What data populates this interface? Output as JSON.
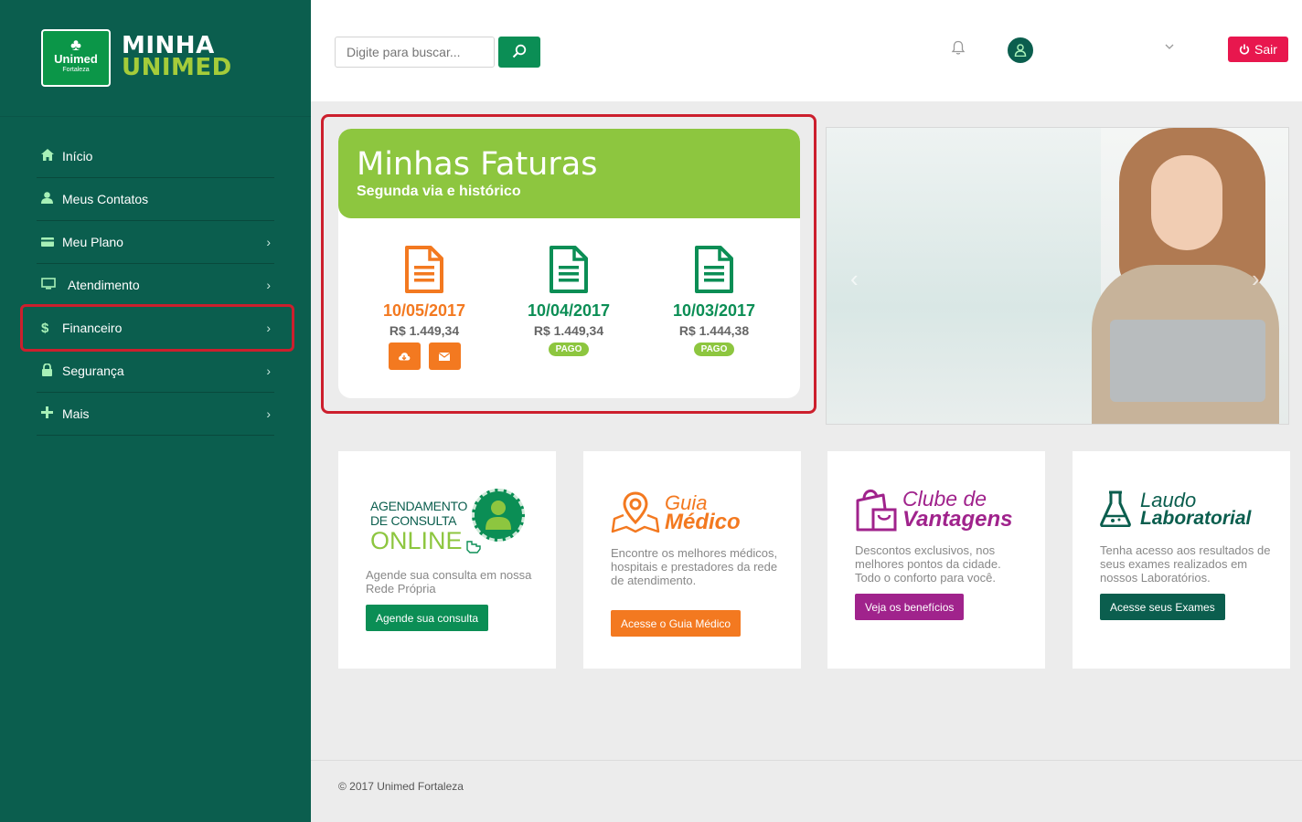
{
  "brand": {
    "logo_name": "Unimed",
    "logo_city": "Fortaleza",
    "title_line1": "MINHA",
    "title_line2": "UNIMED"
  },
  "sidebar": {
    "items": [
      {
        "label": "Início",
        "icon": "home-icon",
        "has_submenu": false
      },
      {
        "label": "Meus Contatos",
        "icon": "user-icon",
        "has_submenu": false
      },
      {
        "label": "Meu Plano",
        "icon": "card-icon",
        "has_submenu": true
      },
      {
        "label": "Atendimento",
        "icon": "monitor-icon",
        "has_submenu": true
      },
      {
        "label": "Financeiro",
        "icon": "dollar-icon",
        "has_submenu": true,
        "highlighted": true
      },
      {
        "label": "Segurança",
        "icon": "lock-icon",
        "has_submenu": true
      },
      {
        "label": "Mais",
        "icon": "plus-icon",
        "has_submenu": true
      }
    ]
  },
  "topbar": {
    "search_placeholder": "Digite para buscar...",
    "logout_label": "Sair"
  },
  "invoices": {
    "title": "Minhas Faturas",
    "subtitle": "Segunda via e histórico",
    "items": [
      {
        "date": "10/05/2017",
        "amount": "R$ 1.449,34",
        "status": "",
        "color": "#f37920"
      },
      {
        "date": "10/04/2017",
        "amount": "R$ 1.449,34",
        "status": "PAGO",
        "color": "#0b8e55"
      },
      {
        "date": "10/03/2017",
        "amount": "R$ 1.444,38",
        "status": "PAGO",
        "color": "#0b8e55"
      }
    ]
  },
  "features": {
    "agendamento": {
      "title_line1": "AGENDAMENTO",
      "title_line2": "DE CONSULTA",
      "title_line3": "ONLINE",
      "description": "Agende sua consulta em nossa Rede Própria",
      "button": "Agende sua consulta",
      "color": "#0b8e55"
    },
    "guia": {
      "title_line1": "Guia",
      "title_line2": "Médico",
      "description": "Encontre os melhores médicos, hospitais e prestadores da rede de atendimento.",
      "button": "Acesse o Guia Médico",
      "color": "#f37920"
    },
    "clube": {
      "title_line1": "Clube de",
      "title_line2": "Vantagens",
      "description": "Descontos exclusivos, nos melhores pontos da cidade. Todo o conforto para você.",
      "button": "Veja os benefícios",
      "color": "#a0238c"
    },
    "laudo": {
      "title_line1": "Laudo",
      "title_line2": "Laboratorial",
      "description": "Tenha acesso aos resultados de seus exames realizados em nossos Laboratórios.",
      "button": "Acesse seus Exames",
      "color": "#0b5e4e"
    }
  },
  "footer": {
    "text": "© 2017 Unimed Fortaleza"
  }
}
